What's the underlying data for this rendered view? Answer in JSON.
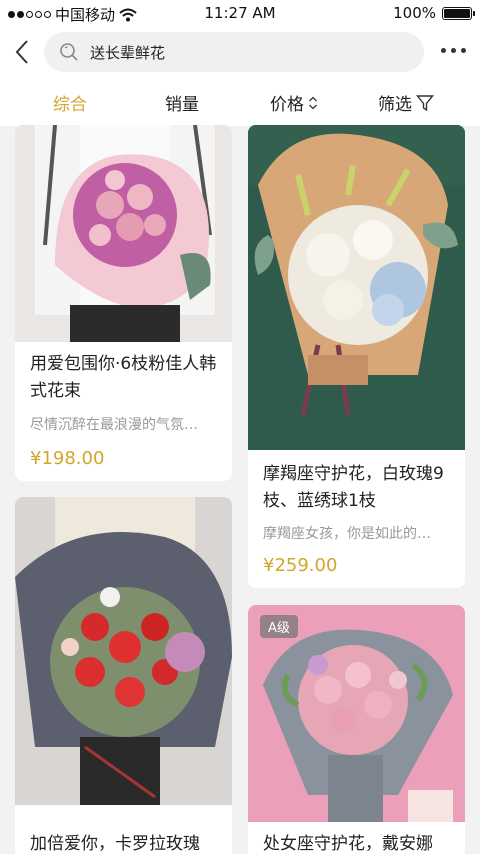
{
  "status_bar": {
    "carrier": "中国移动",
    "time": "11:27 AM",
    "battery": "100%"
  },
  "search": {
    "value": "送长辈鲜花"
  },
  "sort_tabs": [
    {
      "label": "综合",
      "active": true
    },
    {
      "label": "销量",
      "active": false
    },
    {
      "label": "价格",
      "active": false
    },
    {
      "label": "筛选",
      "active": false
    }
  ],
  "products": [
    {
      "title": "用爱包围你·6枝粉佳人韩式花束",
      "desc": "尽情沉醉在最浪漫的气氛…",
      "price": "¥198.00",
      "badge": ""
    },
    {
      "title": "摩羯座守护花，白玫瑰9枝、蓝绣球1枝",
      "desc": "摩羯座女孩，你是如此的…",
      "price": "¥259.00",
      "badge": ""
    },
    {
      "title": "加倍爱你，卡罗拉玫瑰",
      "desc": "",
      "price": "",
      "badge": ""
    },
    {
      "title": "处女座守护花，戴安娜",
      "desc": "",
      "price": "",
      "badge": "A级"
    }
  ],
  "colors": {
    "accent": "#d4a52e",
    "background": "#f2f2f2"
  }
}
